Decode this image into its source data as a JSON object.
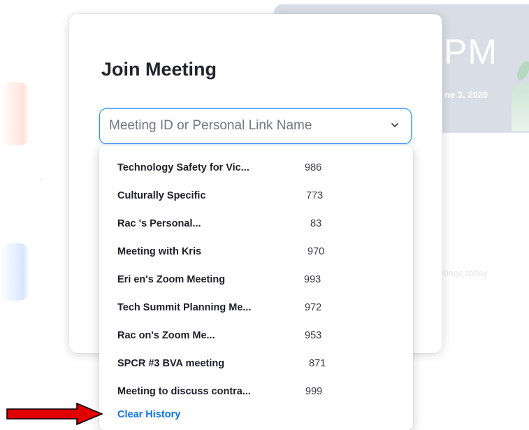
{
  "background": {
    "time_fragment": "PM",
    "date_fragment": "ne 3, 2020",
    "meetings_fragment": "etings today"
  },
  "dialog": {
    "title": "Join Meeting",
    "input": {
      "placeholder": "Meeting ID or Personal Link Name",
      "value": ""
    }
  },
  "history": {
    "items": [
      {
        "name": "Technology Safety for Vic...",
        "id": "986"
      },
      {
        "name": "Culturally Specific",
        "id": "773"
      },
      {
        "name": "Rac          's Personal...",
        "id": "83"
      },
      {
        "name": "Meeting with Kris",
        "id": "970"
      },
      {
        "name": "Eri           en's Zoom Meeting",
        "id": "993"
      },
      {
        "name": "Tech Summit Planning Me...",
        "id": "972"
      },
      {
        "name": "Rac         on's Zoom Me...",
        "id": "953"
      },
      {
        "name": "SPCR #3 BVA meeting",
        "id": "871"
      },
      {
        "name": "Meeting to discuss contra...",
        "id": "999"
      }
    ],
    "clear_label": "Clear History"
  },
  "colors": {
    "accent": "#2d8cff",
    "link": "#0e72ed",
    "annotation_arrow": "#e00000"
  }
}
